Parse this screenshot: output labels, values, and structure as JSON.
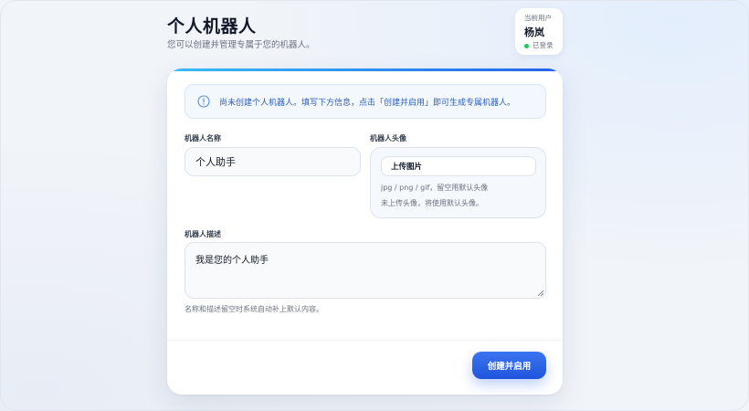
{
  "header": {
    "title": "个人机器人",
    "subtitle": "您可以创建并管理专属于您的机器人。"
  },
  "user": {
    "label": "当前用户",
    "name": "杨岚",
    "status": "已登录"
  },
  "notice": {
    "icon": "info-icon",
    "text": "尚未创建个人机器人。填写下方信息，点击「创建并启用」即可生成专属机器人。"
  },
  "form": {
    "name_label": "机器人名称",
    "name_value": "个人助手",
    "avatar_label": "机器人头像",
    "upload_label": "上传图片",
    "avatar_hint": "jpg / png / gif，留空用默认头像",
    "avatar_status": "未上传头像，将使用默认头像。",
    "desc_label": "机器人描述",
    "desc_value": "我是您的个人助手",
    "helper": "名称和描述留空时系统自动补上默认内容。"
  },
  "actions": {
    "submit_label": "创建并启用"
  },
  "colors": {
    "accent": "#2563eb",
    "status_online": "#22c55e",
    "notice_text": "#2f5fb8"
  }
}
